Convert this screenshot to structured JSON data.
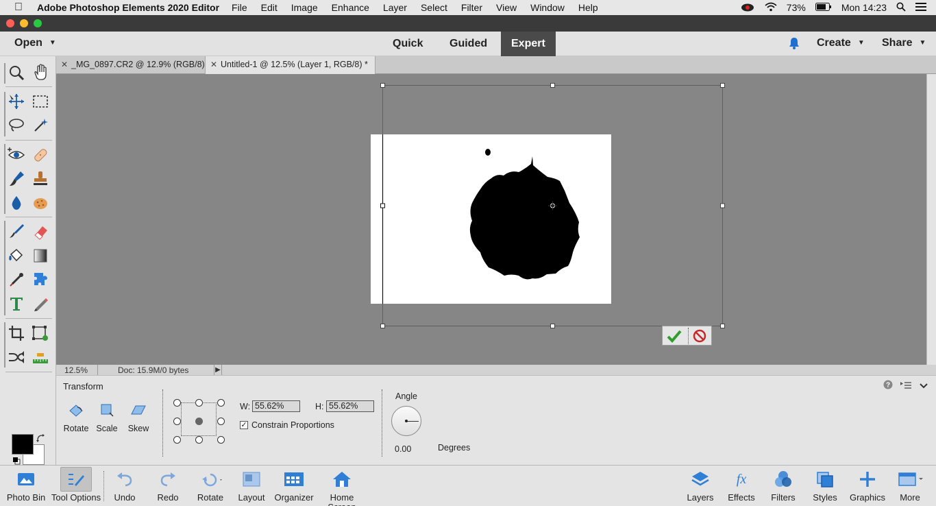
{
  "menubar": {
    "app_name": "Adobe Photoshop Elements 2020 Editor",
    "items": [
      "File",
      "Edit",
      "Image",
      "Enhance",
      "Layer",
      "Select",
      "Filter",
      "View",
      "Window",
      "Help"
    ],
    "battery": "73%",
    "clock": "Mon 14:23"
  },
  "modebar": {
    "open_label": "Open",
    "tabs": [
      "Quick",
      "Guided",
      "Expert"
    ],
    "active_tab": "Expert",
    "create_label": "Create",
    "share_label": "Share"
  },
  "doc_tabs": [
    {
      "label": "_MG_0897.CR2 @ 12.9% (RGB/8)",
      "active": false
    },
    {
      "label": "Untitled-1 @ 12.5% (Layer 1, RGB/8) *",
      "active": true
    }
  ],
  "status": {
    "zoom": "12.5%",
    "doc_info": "Doc: 15.9M/0 bytes"
  },
  "tool_options": {
    "title": "Transform",
    "modes": [
      "Rotate",
      "Scale",
      "Skew"
    ],
    "width_label": "W:",
    "width_value": "55.62%",
    "height_label": "H:",
    "height_value": "55.62%",
    "constrain_label": "Constrain Proportions",
    "constrain_checked": true,
    "angle_label": "Angle",
    "angle_value": "0.00",
    "degrees_label": "Degrees"
  },
  "bottombar": {
    "left": [
      "Photo Bin",
      "Tool Options",
      "Undo",
      "Redo",
      "Rotate",
      "Layout",
      "Organizer",
      "Home Screen"
    ],
    "right": [
      "Layers",
      "Effects",
      "Filters",
      "Styles",
      "Graphics",
      "More"
    ],
    "active": "Tool Options"
  },
  "colors": {
    "accent": "#1f6fd0",
    "commit": "#2e9e2e",
    "cancel": "#c62828"
  }
}
